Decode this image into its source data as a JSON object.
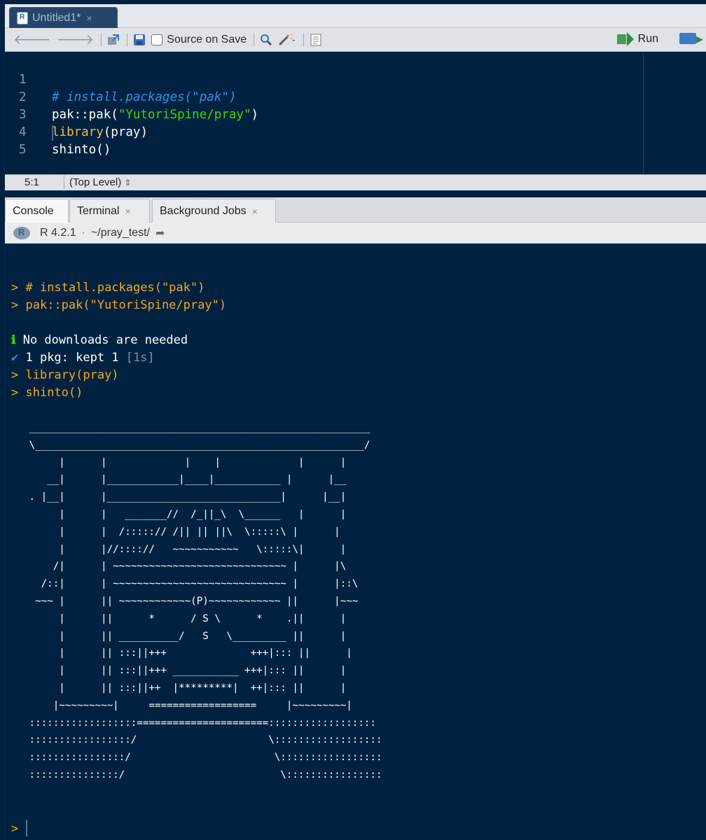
{
  "editor": {
    "tab": {
      "title": "Untitled1*",
      "close": "×",
      "icon": "r-file-icon"
    },
    "toolbar": {
      "source_on_save_label": "Source on Save",
      "source_on_save_checked": false,
      "run_label": "Run"
    },
    "lines": [
      {
        "num": "1",
        "text": "# install.packages(\"pak\")"
      },
      {
        "num": "2",
        "prefix": "pak::pak(",
        "string": "\"YutoriSpine/pray\"",
        "suffix": ")"
      },
      {
        "num": "3",
        "func": "library",
        "rest": "(pray)"
      },
      {
        "num": "4",
        "text": "shinto()"
      },
      {
        "num": "5",
        "text": ""
      }
    ],
    "status": {
      "position": "5:1",
      "scope": "(Top Level)",
      "scope_arrow": "⇕"
    }
  },
  "console": {
    "tabs": [
      {
        "label": "Console",
        "active": true
      },
      {
        "label": "Terminal",
        "close": "×"
      },
      {
        "label": "Background Jobs",
        "close": "×"
      }
    ],
    "header": {
      "r_version": "R 4.2.1",
      "separator": "·",
      "path": "~/pray_test/"
    },
    "output": {
      "prompt": ">",
      "cmd1": " # install.packages(\"pak\")",
      "cmd2": " pak::pak(\"YutoriSpine/pray\")",
      "info_glyph": "ℹ",
      "info_text": " No downloads are needed",
      "check_glyph": "✔",
      "check_text": " 1 pkg: kept 1 ",
      "check_time": "[1s]",
      "cmd3": " library(pray)",
      "cmd4": " shinto()",
      "ascii_art": " _________________________________________________________\n \\_______________________________________________________/\n      |      |             |    |             |      |\n    __|      |____________|____|___________ |      |__\n . |__|      |_____________________________|      |__|\n      |      |   _______//  /_||_\\  \\______   |      |\n      |      |  /:::::// /|| || ||\\  \\:::::\\ |      |\n      |      |//:::://   ~~~~~~~~~~~   \\:::::\\|      |\n     /|      | ~~~~~~~~~~~~~~~~~~~~~~~~~~~~~ |      |\\\n   /::|      | ~~~~~~~~~~~~~~~~~~~~~~~~~~~~~ |      |::\\\n  ~~~ |      || ~~~~~~~~~~~~(P)~~~~~~~~~~~~ ||      |~~~\n      |      ||      *      / S \\      *    .||      |\n      |      || __________/   S   \\_________ ||      |\n      |      || :::||+++              +++|::: ||      |\n      |      || :::||+++ ___________ +++|::: ||      |\n      |      || :::||++  |*********|  ++|::: ||      |\n     |~~~~~~~~~|     ==================     |~~~~~~~~~|\n ::::::::::::::::::======================::::::::::::::::::\n :::::::::::::::::/                      \\::::::::::::::::::\n ::::::::::::::::/                        \\:::::::::::::::::\n :::::::::::::::/                          \\::::::::::::::::"
    }
  },
  "colors": {
    "background": "#002240",
    "prompt": "#f6a623",
    "string": "#3ad900",
    "comment": "#2f8fe8",
    "function": "#ffb83e"
  }
}
